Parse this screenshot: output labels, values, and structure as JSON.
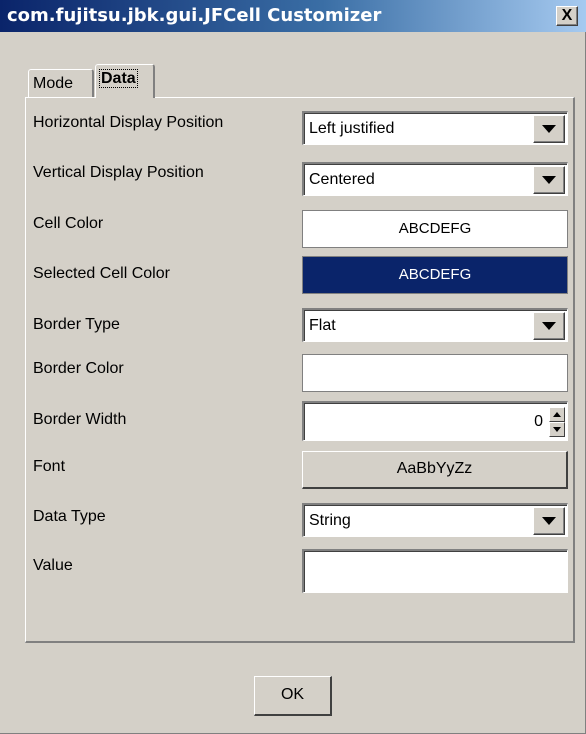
{
  "window": {
    "title": "com.fujitsu.jbk.gui.JFCell Customizer",
    "close_glyph": "X"
  },
  "tabs": [
    {
      "label": "Mode",
      "selected": false
    },
    {
      "label": "Data",
      "selected": true
    }
  ],
  "properties": {
    "horizontal_display_position": {
      "label": "Horizontal Display Position",
      "value": "Left justified"
    },
    "vertical_display_position": {
      "label": "Vertical Display Position",
      "value": "Centered"
    },
    "cell_color": {
      "label": "Cell Color",
      "preview": "ABCDEFG",
      "color": "#ffffff"
    },
    "selected_cell_color": {
      "label": "Selected Cell Color",
      "preview": "ABCDEFG",
      "color": "#0a246a"
    },
    "border_type": {
      "label": "Border Type",
      "value": "Flat"
    },
    "border_color": {
      "label": "Border Color",
      "value": ""
    },
    "border_width": {
      "label": "Border Width",
      "value": "0"
    },
    "font": {
      "label": "Font",
      "preview": "AaBbYyZz"
    },
    "data_type": {
      "label": "Data Type",
      "value": "String"
    },
    "value": {
      "label": "Value",
      "value": ""
    }
  },
  "buttons": {
    "ok_label": "OK"
  },
  "icons": {
    "dropdown": "chevron-down-icon",
    "spin_up": "arrow-up-icon",
    "spin_down": "arrow-down-icon",
    "close": "close-icon"
  }
}
